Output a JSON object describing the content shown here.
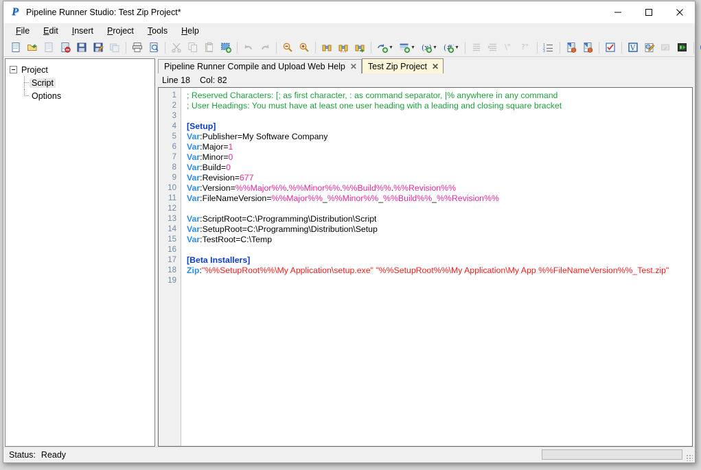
{
  "window": {
    "title": "Pipeline Runner Studio: Test Zip Project*",
    "app_icon": "pipeline-runner-logo",
    "minimize_label": "Minimize",
    "maximize_label": "Maximize",
    "close_label": "Close"
  },
  "menu": [
    {
      "name": "file",
      "label": "File",
      "accel": "F"
    },
    {
      "name": "edit",
      "label": "Edit",
      "accel": "E"
    },
    {
      "name": "insert",
      "label": "Insert",
      "accel": "I"
    },
    {
      "name": "project",
      "label": "Project",
      "accel": "P"
    },
    {
      "name": "tools",
      "label": "Tools",
      "accel": "T"
    },
    {
      "name": "help",
      "label": "Help",
      "accel": "H"
    }
  ],
  "toolbar": {
    "groups": [
      {
        "name": "file-group",
        "buttons": [
          {
            "name": "new-file-button",
            "icon": "new-document-icon",
            "title": "New",
            "disabled": false,
            "dropdown": false
          },
          {
            "name": "open-file-button",
            "icon": "open-folder-icon",
            "title": "Open",
            "disabled": false,
            "dropdown": false
          },
          {
            "name": "close-file-button",
            "icon": "close-document-icon",
            "title": "Close",
            "disabled": true,
            "dropdown": false
          },
          {
            "name": "delete-file-button",
            "icon": "delete-document-icon",
            "title": "Delete",
            "disabled": false,
            "dropdown": false
          },
          {
            "name": "save-button",
            "icon": "floppy-save-icon",
            "title": "Save",
            "disabled": false,
            "dropdown": false
          },
          {
            "name": "save-as-button",
            "icon": "floppy-save-as-icon",
            "title": "Save As",
            "disabled": false,
            "dropdown": false
          },
          {
            "name": "save-all-button",
            "icon": "save-all-icon",
            "title": "Save All",
            "disabled": true,
            "dropdown": false
          }
        ]
      },
      {
        "name": "print-group",
        "buttons": [
          {
            "name": "print-button",
            "icon": "printer-icon",
            "title": "Print",
            "disabled": false,
            "dropdown": false
          },
          {
            "name": "print-preview-button",
            "icon": "print-preview-icon",
            "title": "Print Preview",
            "disabled": false,
            "dropdown": false
          }
        ]
      },
      {
        "name": "clipboard-group",
        "buttons": [
          {
            "name": "cut-button",
            "icon": "scissors-icon",
            "title": "Cut",
            "disabled": true,
            "dropdown": false
          },
          {
            "name": "copy-button",
            "icon": "copy-icon",
            "title": "Copy",
            "disabled": true,
            "dropdown": false
          },
          {
            "name": "paste-button",
            "icon": "paste-icon",
            "title": "Paste",
            "disabled": true,
            "dropdown": false
          },
          {
            "name": "select-all-button",
            "icon": "select-all-icon",
            "title": "Select All",
            "disabled": false,
            "dropdown": false
          }
        ]
      },
      {
        "name": "undo-group",
        "buttons": [
          {
            "name": "undo-button",
            "icon": "undo-arrow-icon",
            "title": "Undo",
            "disabled": true,
            "dropdown": false
          },
          {
            "name": "redo-button",
            "icon": "redo-arrow-icon",
            "title": "Redo",
            "disabled": true,
            "dropdown": false
          }
        ]
      },
      {
        "name": "zoom-group",
        "buttons": [
          {
            "name": "zoom-out-button",
            "icon": "magnifier-minus-icon",
            "title": "Zoom Out",
            "disabled": false,
            "dropdown": false
          },
          {
            "name": "zoom-in-button",
            "icon": "magnifier-plus-icon",
            "title": "Zoom In",
            "disabled": false,
            "dropdown": false
          }
        ]
      },
      {
        "name": "find-group",
        "buttons": [
          {
            "name": "find-button",
            "icon": "binoculars-icon",
            "title": "Find",
            "disabled": false,
            "dropdown": false
          },
          {
            "name": "find-next-button",
            "icon": "binoculars-next-icon",
            "title": "Find Next",
            "disabled": false,
            "dropdown": false
          },
          {
            "name": "replace-button",
            "icon": "binoculars-replace-icon",
            "title": "Replace",
            "disabled": false,
            "dropdown": false
          }
        ]
      },
      {
        "name": "insert-group",
        "buttons": [
          {
            "name": "insert-command-button",
            "icon": "insert-command-icon",
            "title": "Insert Command",
            "disabled": false,
            "dropdown": true
          },
          {
            "name": "insert-heading-button",
            "icon": "insert-heading-icon",
            "title": "Insert Heading",
            "disabled": false,
            "dropdown": true
          },
          {
            "name": "insert-variable-button",
            "icon": "insert-variable-icon",
            "title": "Insert Variable",
            "disabled": false,
            "dropdown": true
          },
          {
            "name": "insert-number-button",
            "icon": "insert-number-icon",
            "title": "Insert Number",
            "disabled": false,
            "dropdown": true
          }
        ]
      },
      {
        "name": "indent-group",
        "buttons": [
          {
            "name": "indent-button",
            "icon": "indent-icon",
            "title": "Indent",
            "disabled": true,
            "dropdown": false
          },
          {
            "name": "outdent-button",
            "icon": "outdent-icon",
            "title": "Outdent",
            "disabled": true,
            "dropdown": false
          },
          {
            "name": "comment-button",
            "icon": "comment-lines-icon",
            "title": "Comment",
            "disabled": true,
            "dropdown": false
          },
          {
            "name": "uncomment-button",
            "icon": "uncomment-lines-icon",
            "title": "Uncomment",
            "disabled": true,
            "dropdown": false
          }
        ]
      },
      {
        "name": "list-group",
        "buttons": [
          {
            "name": "line-numbers-button",
            "icon": "numbered-list-icon",
            "title": "Line Numbers",
            "disabled": false,
            "dropdown": false
          }
        ]
      },
      {
        "name": "project-group",
        "buttons": [
          {
            "name": "import-project-button",
            "icon": "import-page-icon",
            "title": "Import",
            "disabled": false,
            "dropdown": false
          },
          {
            "name": "export-project-button",
            "icon": "export-page-icon",
            "title": "Export",
            "disabled": false,
            "dropdown": false
          }
        ]
      },
      {
        "name": "check-group",
        "buttons": [
          {
            "name": "validate-button",
            "icon": "checklist-icon",
            "title": "Validate Script",
            "disabled": false,
            "dropdown": false
          }
        ]
      },
      {
        "name": "run-group",
        "buttons": [
          {
            "name": "variables-button",
            "icon": "variables-window-icon",
            "title": "Variables",
            "disabled": false,
            "dropdown": false
          },
          {
            "name": "options-button",
            "icon": "options-pencil-icon",
            "title": "Options",
            "disabled": false,
            "dropdown": false
          },
          {
            "name": "step-button",
            "icon": "step-run-icon",
            "title": "Step",
            "disabled": true,
            "dropdown": false
          },
          {
            "name": "run-button",
            "icon": "run-green-arrow-icon",
            "title": "Run",
            "disabled": false,
            "dropdown": false
          }
        ]
      },
      {
        "name": "help-group",
        "buttons": [
          {
            "name": "help-button",
            "icon": "question-help-icon",
            "title": "Help",
            "disabled": false,
            "dropdown": false
          },
          {
            "name": "about-button",
            "icon": "info-about-icon",
            "title": "About",
            "disabled": false,
            "dropdown": false
          }
        ]
      }
    ]
  },
  "tree": {
    "root": {
      "name": "tree-node-project",
      "label": "Project",
      "expanded": true
    },
    "children": [
      {
        "name": "tree-node-script",
        "label": "Script",
        "selected": true
      },
      {
        "name": "tree-node-options",
        "label": "Options",
        "selected": false
      }
    ]
  },
  "tabs": [
    {
      "name": "tab-web-help",
      "label": "Pipeline Runner Compile and Upload Web Help",
      "active": false,
      "close": "✕"
    },
    {
      "name": "tab-test-zip-project",
      "label": "Test Zip Project",
      "active": true,
      "close": "✕"
    }
  ],
  "editor_status": {
    "line_label": "Line 18",
    "col_label": "Col: 82"
  },
  "editor": {
    "line_count": 19,
    "lines": [
      {
        "n": 1,
        "spans": [
          {
            "t": "; Reserved Characters: [; as first character, : as command separator, |% anywhere in any command",
            "c": "comment"
          }
        ]
      },
      {
        "n": 2,
        "spans": [
          {
            "t": "; User Headings: You must have at least one user heading with a leading and closing square bracket",
            "c": "comment"
          }
        ]
      },
      {
        "n": 3,
        "spans": []
      },
      {
        "n": 4,
        "spans": [
          {
            "t": "[Setup]",
            "c": "section"
          }
        ]
      },
      {
        "n": 5,
        "spans": [
          {
            "t": "Var",
            "c": "cmd"
          },
          {
            "t": ":Publisher=My Software Company",
            "c": "plain"
          }
        ]
      },
      {
        "n": 6,
        "spans": [
          {
            "t": "Var",
            "c": "cmd"
          },
          {
            "t": ":Major=",
            "c": "plain"
          },
          {
            "t": "1",
            "c": "num"
          }
        ]
      },
      {
        "n": 7,
        "spans": [
          {
            "t": "Var",
            "c": "cmd"
          },
          {
            "t": ":Minor=",
            "c": "plain"
          },
          {
            "t": "0",
            "c": "num"
          }
        ]
      },
      {
        "n": 8,
        "spans": [
          {
            "t": "Var",
            "c": "cmd"
          },
          {
            "t": ":Build=",
            "c": "plain"
          },
          {
            "t": "0",
            "c": "num"
          }
        ]
      },
      {
        "n": 9,
        "spans": [
          {
            "t": "Var",
            "c": "cmd"
          },
          {
            "t": ":Revision=",
            "c": "plain"
          },
          {
            "t": "677",
            "c": "num"
          }
        ]
      },
      {
        "n": 10,
        "spans": [
          {
            "t": "Var",
            "c": "cmd"
          },
          {
            "t": ":Version=",
            "c": "plain"
          },
          {
            "t": "%%Major%%",
            "c": "var"
          },
          {
            "t": ".",
            "c": "plain"
          },
          {
            "t": "%%Minor%%",
            "c": "var"
          },
          {
            "t": ".",
            "c": "plain"
          },
          {
            "t": "%%Build%%",
            "c": "var"
          },
          {
            "t": ".",
            "c": "plain"
          },
          {
            "t": "%%Revision%%",
            "c": "var"
          }
        ]
      },
      {
        "n": 11,
        "spans": [
          {
            "t": "Var",
            "c": "cmd"
          },
          {
            "t": ":FileNameVersion=",
            "c": "plain"
          },
          {
            "t": "%%Major%%",
            "c": "var"
          },
          {
            "t": "_",
            "c": "plain"
          },
          {
            "t": "%%Minor%%",
            "c": "var"
          },
          {
            "t": "_",
            "c": "plain"
          },
          {
            "t": "%%Build%%",
            "c": "var"
          },
          {
            "t": "_",
            "c": "plain"
          },
          {
            "t": "%%Revision%%",
            "c": "var"
          }
        ]
      },
      {
        "n": 12,
        "spans": []
      },
      {
        "n": 13,
        "spans": [
          {
            "t": "Var",
            "c": "cmd"
          },
          {
            "t": ":ScriptRoot=C:\\Programming\\Distribution\\Script",
            "c": "plain"
          }
        ]
      },
      {
        "n": 14,
        "spans": [
          {
            "t": "Var",
            "c": "cmd"
          },
          {
            "t": ":SetupRoot=C:\\Programming\\Distribution\\Setup",
            "c": "plain"
          }
        ]
      },
      {
        "n": 15,
        "spans": [
          {
            "t": "Var",
            "c": "cmd"
          },
          {
            "t": ":TestRoot=C:\\Temp",
            "c": "plain"
          }
        ]
      },
      {
        "n": 16,
        "spans": []
      },
      {
        "n": 17,
        "spans": [
          {
            "t": "[Beta Installers]",
            "c": "section"
          }
        ]
      },
      {
        "n": 18,
        "spans": [
          {
            "t": "Zip",
            "c": "cmd"
          },
          {
            "t": ":",
            "c": "plain"
          },
          {
            "t": "\"%%SetupRoot%%\\My Application\\setup.exe\" \"%%SetupRoot%%\\My Application\\My App %%FileNameVersion%%_Test.zip\"",
            "c": "str"
          }
        ]
      },
      {
        "n": 19,
        "spans": []
      }
    ]
  },
  "statusbar": {
    "label": "Status:",
    "value": "Ready",
    "progress_percent": 0
  },
  "colors": {
    "comment": "#1f9e3e",
    "section": "#0a3bd4",
    "command": "#2d8cf0",
    "variable": "#e0279d",
    "string": "#f01d1d",
    "active_tab_bg": "#fdf6d8",
    "gutter_bg": "#f0f0f0",
    "line_number": "#6f89a8"
  }
}
